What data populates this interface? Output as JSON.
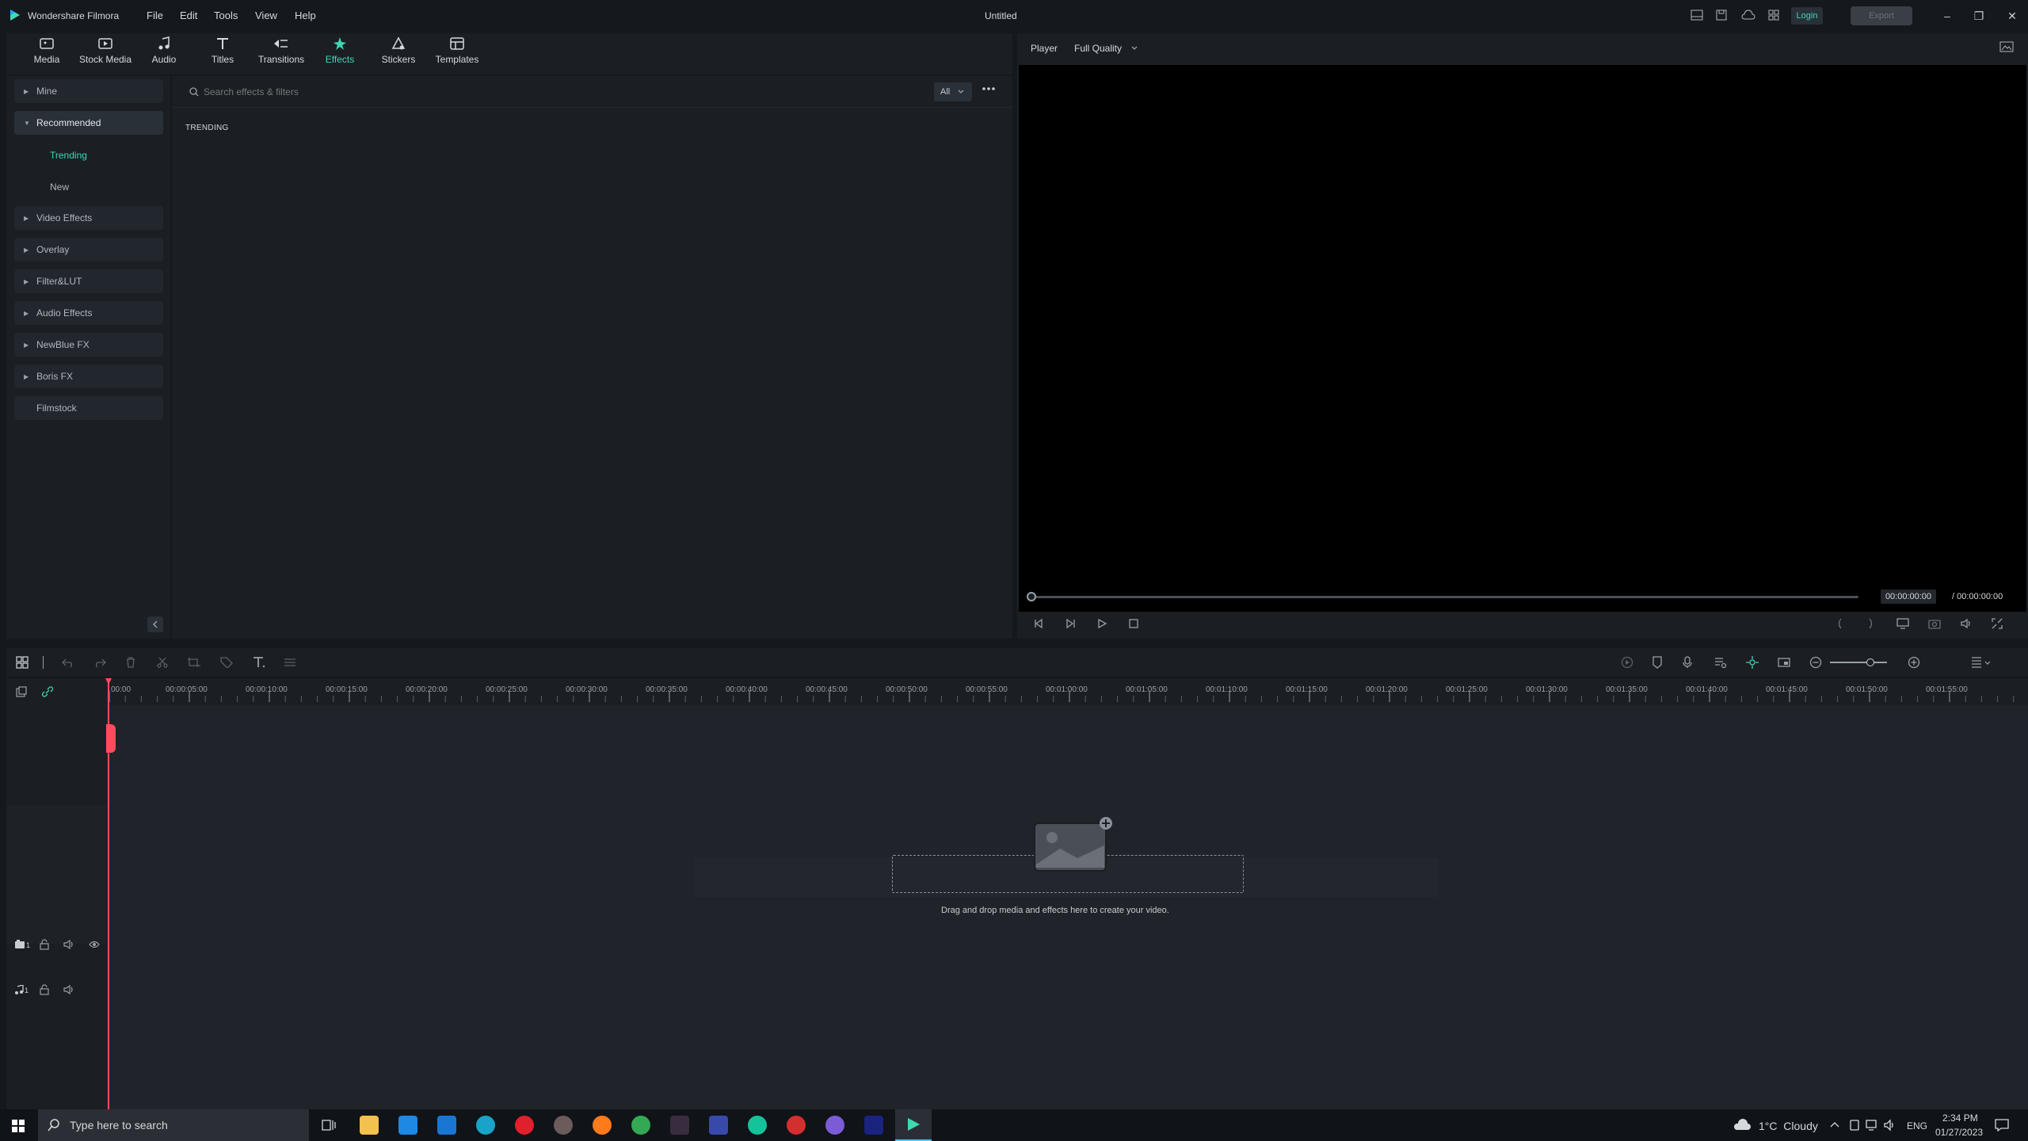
{
  "app": {
    "name": "Wondershare Filmora",
    "doc_title": "Untitled",
    "menu": [
      "File",
      "Edit",
      "Tools",
      "View",
      "Help"
    ],
    "login_label": "Login",
    "export_label": "Export"
  },
  "toolbar": {
    "items": [
      {
        "label": "Media",
        "icon": "media-icon"
      },
      {
        "label": "Stock Media",
        "icon": "stock-media-icon"
      },
      {
        "label": "Audio",
        "icon": "audio-icon"
      },
      {
        "label": "Titles",
        "icon": "titles-icon"
      },
      {
        "label": "Transitions",
        "icon": "transitions-icon"
      },
      {
        "label": "Effects",
        "icon": "effects-icon",
        "active": true
      },
      {
        "label": "Stickers",
        "icon": "stickers-icon"
      },
      {
        "label": "Templates",
        "icon": "templates-icon"
      }
    ]
  },
  "sidebar": {
    "categories": [
      {
        "label": "Mine"
      },
      {
        "label": "Recommended",
        "open": true
      },
      {
        "label": "Video Effects"
      },
      {
        "label": "Overlay"
      },
      {
        "label": "Filter&LUT"
      },
      {
        "label": "Audio Effects"
      },
      {
        "label": "NewBlue FX"
      },
      {
        "label": "Boris FX"
      },
      {
        "label": "Filmstock"
      }
    ],
    "subitems": [
      {
        "label": "Trending",
        "active": true
      },
      {
        "label": "New"
      }
    ]
  },
  "browser": {
    "search_placeholder": "Search effects & filters",
    "filter_value": "All",
    "section_title": "TRENDING"
  },
  "player": {
    "label": "Player",
    "quality": "Full Quality",
    "current_time": "00:00:00:00",
    "total_time": "/ 00:00:00:00"
  },
  "timeline": {
    "ruler_labels": [
      "00:00",
      "00:00:05:00",
      "00:00:10:00",
      "00:00:15:00",
      "00:00:20:00",
      "00:00:25:00",
      "00:00:30:00",
      "00:00:35:00",
      "00:00:40:00",
      "00:00:45:00",
      "00:00:50:00",
      "00:00:55:00",
      "00:01:00:00",
      "00:01:05:00",
      "00:01:10:00",
      "00:01:15:00",
      "00:01:20:00",
      "00:01:25:00",
      "00:01:30:00",
      "00:01:35:00",
      "00:01:40:00",
      "00:01:45:00",
      "00:01:50:00",
      "00:01:55:00"
    ],
    "drop_hint": "Drag and drop media and effects here to create your video.",
    "video_track_num": "1",
    "audio_track_num": "1"
  },
  "taskbar": {
    "search_placeholder": "Type here to search",
    "weather": "1°C  Cloudy",
    "language": "ENG",
    "time": "2:34 PM",
    "date": "01/27/2023"
  },
  "colors": {
    "accent": "#3fd8b4",
    "playhead": "#ff4b5c"
  }
}
